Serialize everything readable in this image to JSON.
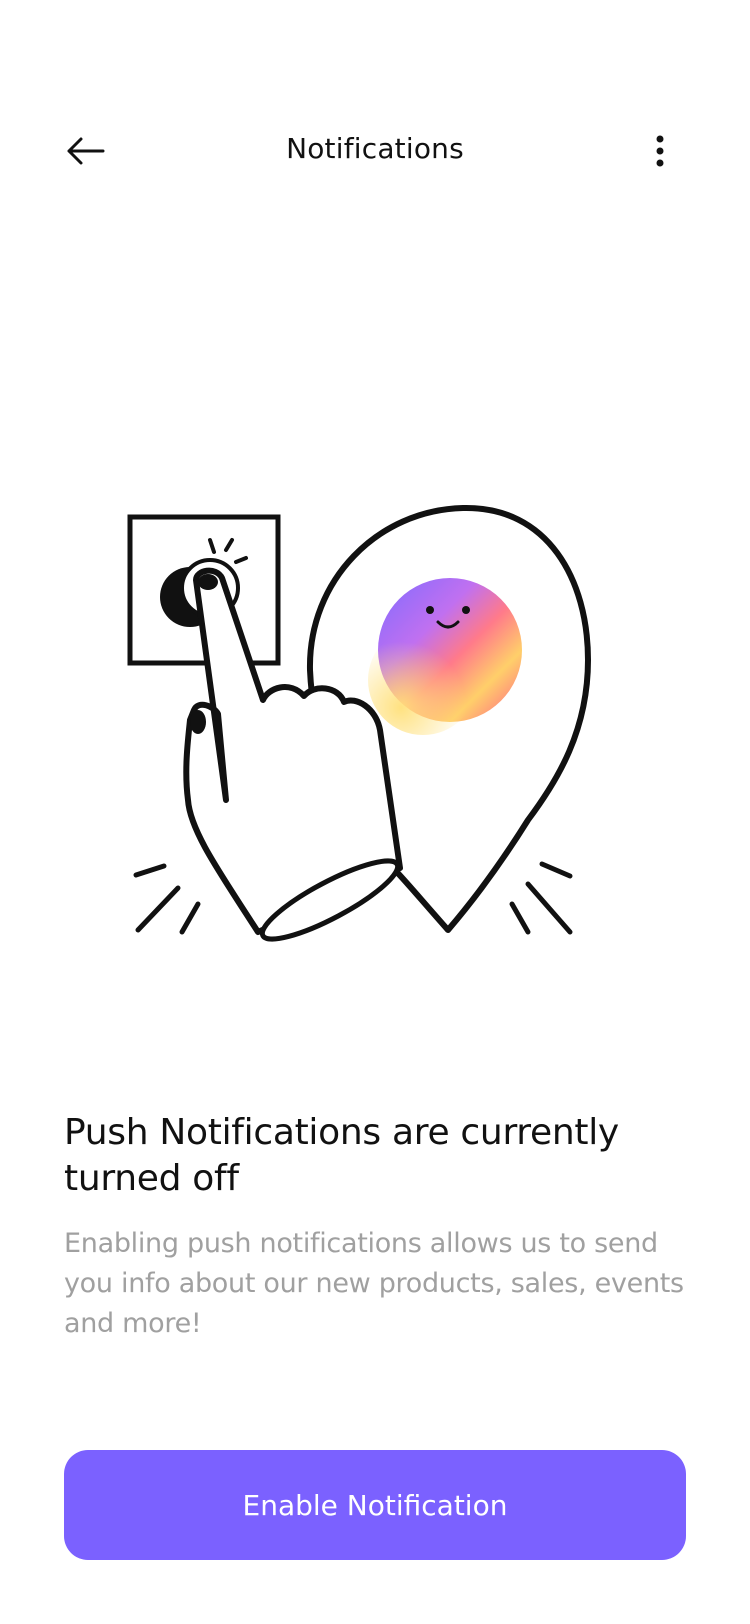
{
  "header": {
    "title": "Notifications",
    "back_icon": "arrow-left-icon",
    "menu_icon": "more-vertical-icon"
  },
  "main": {
    "headline": "Push Notifications are currently turned off",
    "description": "Enabling push notifications allows us to send you info about our new products, sales, events and more!"
  },
  "cta": {
    "label": "Enable Notification"
  },
  "colors": {
    "accent": "#7b61ff",
    "text_primary": "#111111",
    "text_secondary": "#a0a0a0",
    "background": "#ffffff"
  }
}
